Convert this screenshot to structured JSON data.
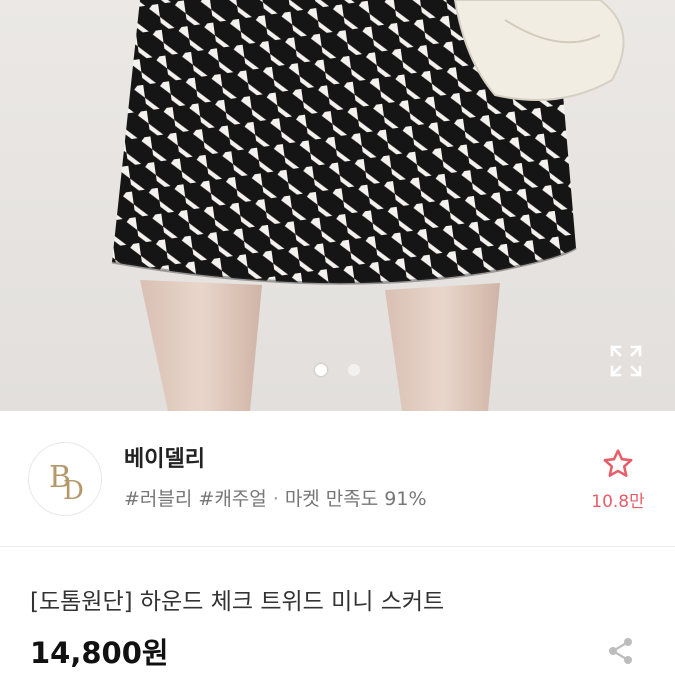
{
  "hero": {
    "image_alt": "houndstooth mini skirt product photo",
    "page_count": 2,
    "active_page": 1
  },
  "shop": {
    "logo_letters": "BD",
    "name": "베이델리",
    "tags": "#러블리 #캐주얼",
    "separator": "·",
    "satisfaction": "마켓 만족도 91%",
    "favorite_count": "10.8만"
  },
  "product": {
    "title": "[도톰원단] 하운드 체크 트위드 미니 스커트",
    "price": "14,800원"
  },
  "colors": {
    "accent": "#e95d6a",
    "logo_gold": "#b5986a"
  },
  "icons": {
    "expand": "expand-icon",
    "favorite": "star-outline-icon",
    "share": "share-icon"
  }
}
